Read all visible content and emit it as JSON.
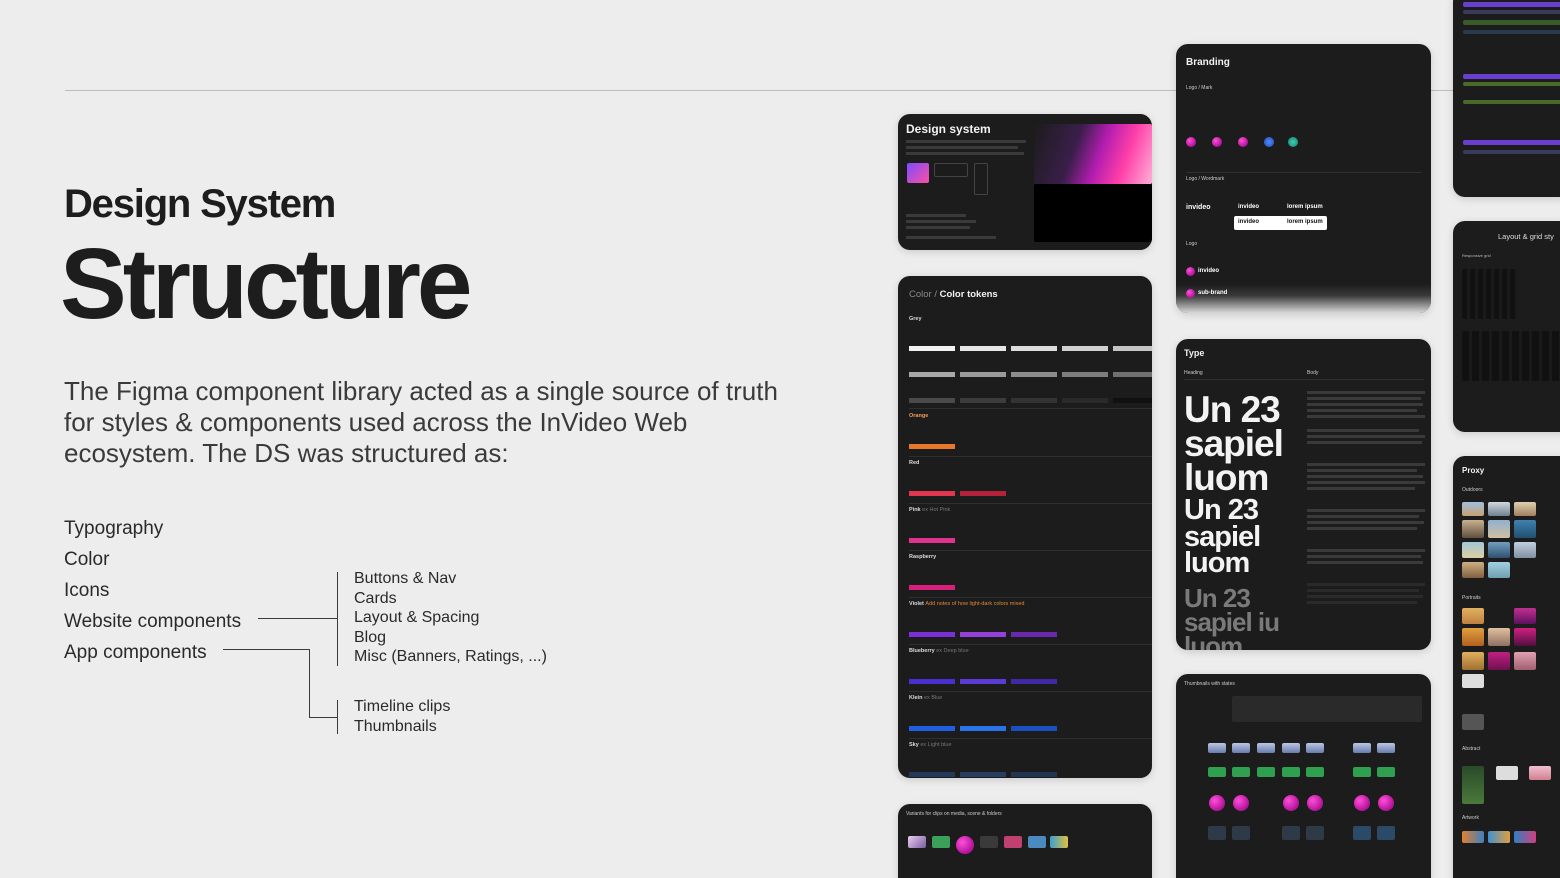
{
  "heading": {
    "kicker": "Design System",
    "title": "Structure",
    "description": "The Figma component library acted as a single source of truth for styles & components used across the InVideo Web ecosystem. The DS was structured as:"
  },
  "structure": {
    "items": [
      "Typography",
      "Color",
      "Icons",
      "Website components",
      "App components"
    ],
    "website_children": [
      "Buttons & Nav",
      "Cards",
      "Layout & Spacing",
      "Blog",
      "Misc (Banners, Ratings, ...)"
    ],
    "app_children": [
      "Timeline clips",
      "Thumbnails"
    ]
  },
  "cards": {
    "design_system": {
      "title": "Design system"
    },
    "color_tokens": {
      "prefix": "Color / ",
      "title": "Color tokens",
      "sections": [
        "Grey",
        "Orange",
        "Red",
        "Pink",
        "Raspberry",
        "Violet",
        "Blueberry",
        "Klein",
        "Sky"
      ],
      "section_notes": {
        "Pink": "ex Hot Pink",
        "Violet": "Add notes of how light-dark colors mixed",
        "Blueberry": "ex Deep blue",
        "Klein": "ex Blue",
        "Sky": "ex Light blue"
      },
      "swatch_colors": {
        "Orange": [
          "#e8772e"
        ],
        "Red": [
          "#e0364f",
          "#b6213a"
        ],
        "Pink": [
          "#e0338f"
        ],
        "Raspberry": [
          "#d6207c"
        ],
        "Violet": [
          "#7b2fd6",
          "#9540d8",
          "#6a28b0"
        ],
        "Blueberry": [
          "#4a2fd0",
          "#5b3ad8",
          "#4028a8"
        ],
        "Klein": [
          "#1f5fe0",
          "#2b73e8",
          "#1a4fc0"
        ],
        "Sky": [
          "#22395a",
          "#263f60",
          "#1f3552"
        ]
      }
    },
    "branding": {
      "title": "Branding",
      "logo_mark_label": "Logo / Mark",
      "logo_wordmark_label": "Logo / Wordmark",
      "logo_label": "Logo",
      "wordmark": "invideo",
      "lorem": "lorem ipsum",
      "sub_brand": "sub-brand"
    },
    "type": {
      "title": "Type",
      "heading_label": "Heading",
      "body_label": "Body",
      "sample_large": "Un 23 sapiel luom",
      "sample_medium": "Un 23 sapiel luom",
      "sample_small": "Un 23 sapiel iu luom"
    },
    "thumbnails": {
      "title": "Thumbnails with states"
    },
    "variants": {
      "title": "Variants for clips on media, scene & folders"
    },
    "layout": {
      "title": "Layout & grid sty",
      "sub": "Responsive grid"
    },
    "proxy": {
      "title": "Proxy",
      "sections": [
        "Outdoors",
        "Portraits",
        "Abstract",
        "Artwork"
      ]
    }
  }
}
